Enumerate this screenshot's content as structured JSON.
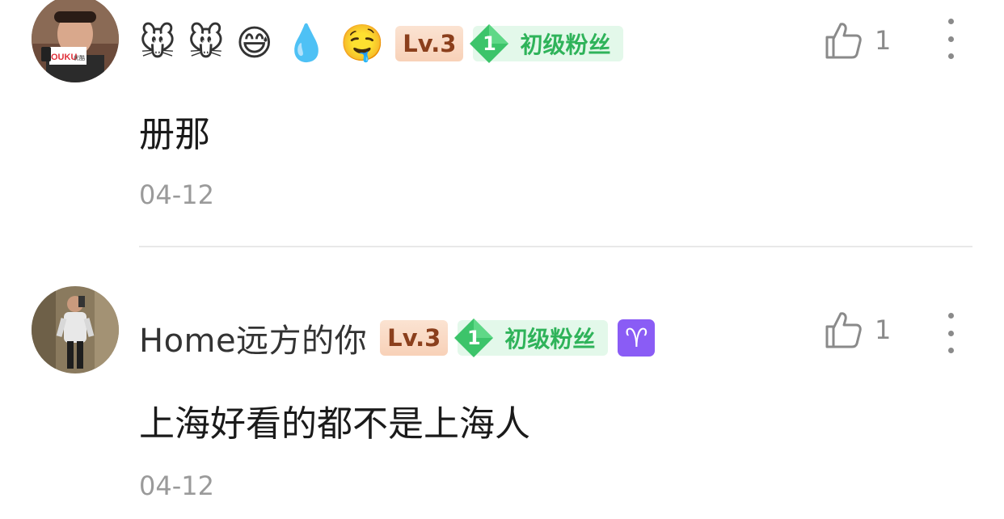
{
  "comments": [
    {
      "name_emoji": [
        "🐭",
        "🐭",
        "😅",
        "💧",
        "🤤"
      ],
      "level": "Lv.3",
      "fan_level_number": "1",
      "fan_badge": "初级粉丝",
      "likes": "1",
      "text": "册那",
      "date": "04-12"
    },
    {
      "username": "Home远方的你",
      "level": "Lv.3",
      "fan_level_number": "1",
      "fan_badge": "初级粉丝",
      "zodiac": "♈",
      "likes": "1",
      "text": "上海好看的都不是上海人",
      "date": "04-12"
    }
  ],
  "colors": {
    "level_text": "#8b3f1c",
    "fan_green": "#2fb35a",
    "zodiac_purple": "#8a5cf5",
    "meta_gray": "#9a9a9a"
  },
  "icons": {
    "like": "thumbs-up-icon",
    "more": "more-vertical-icon",
    "fan_gem": "gem-icon"
  }
}
